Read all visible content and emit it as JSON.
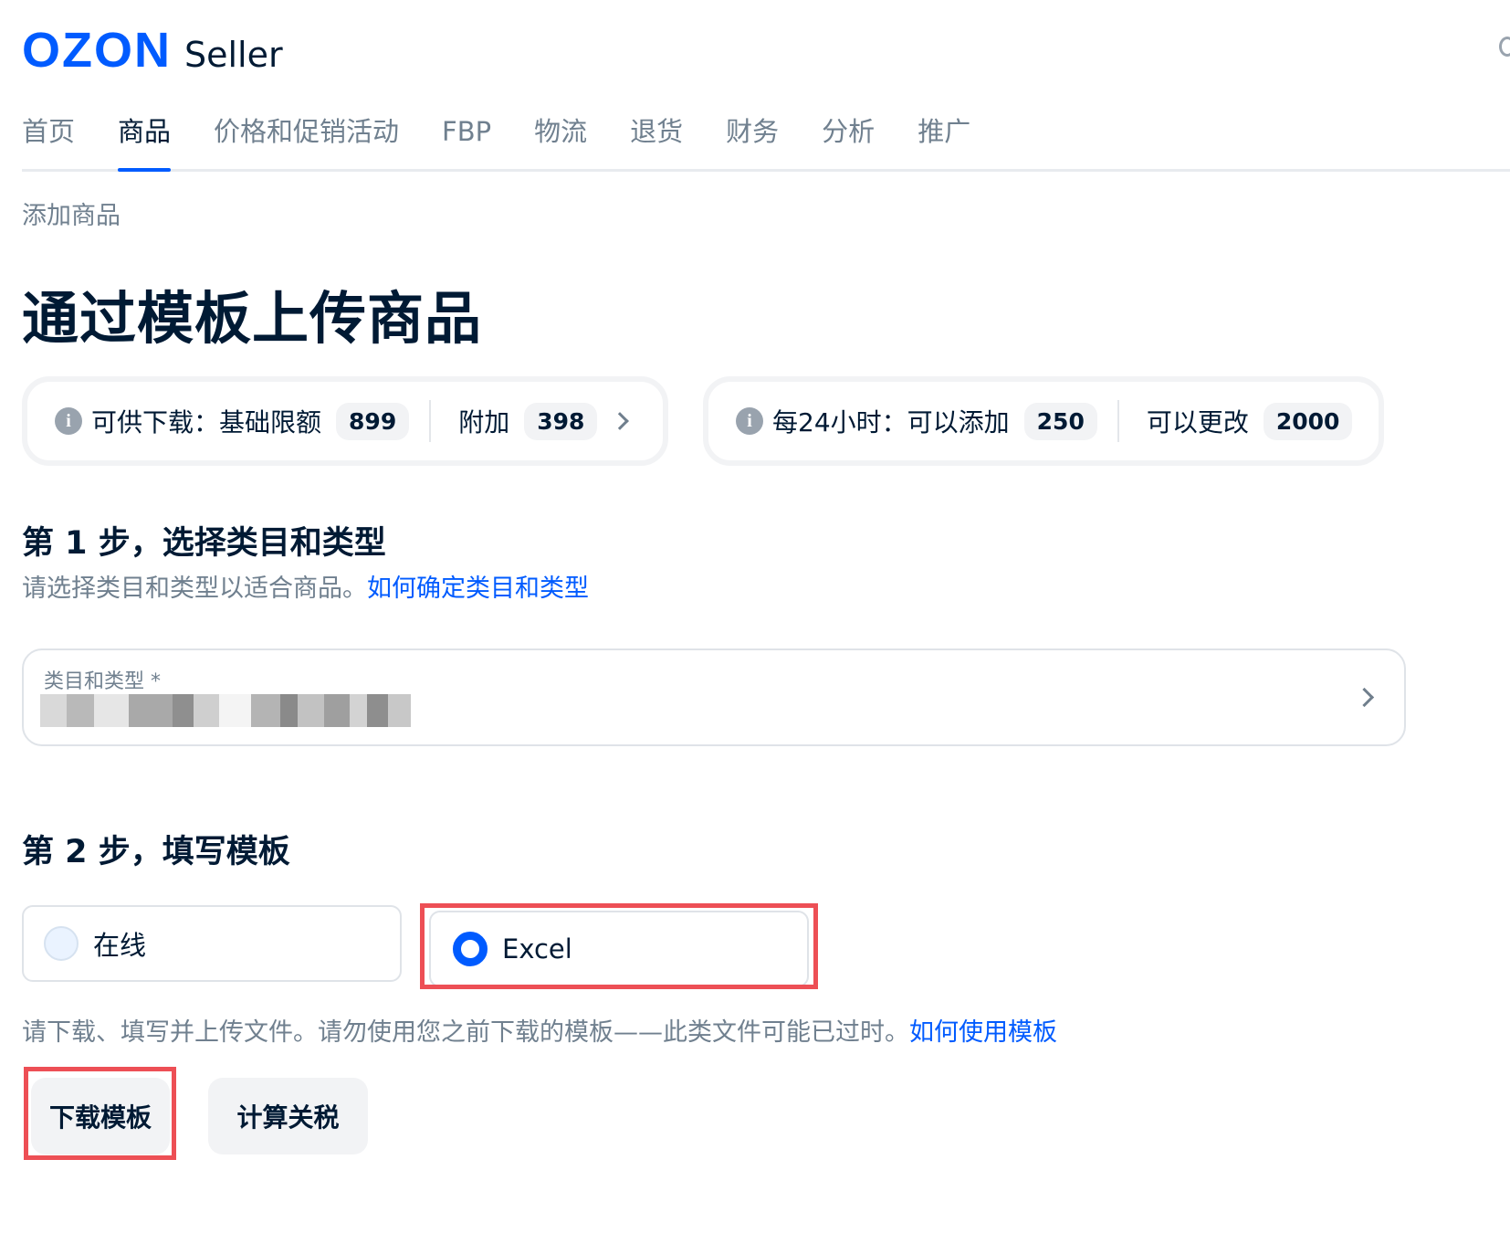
{
  "header": {
    "logo_brand": "OZON",
    "logo_product": "Seller"
  },
  "nav": {
    "items": [
      {
        "label": "首页",
        "active": false
      },
      {
        "label": "商品",
        "active": true
      },
      {
        "label": "价格和促销活动",
        "active": false
      },
      {
        "label": "FBP",
        "active": false
      },
      {
        "label": "物流",
        "active": false
      },
      {
        "label": "退货",
        "active": false
      },
      {
        "label": "财务",
        "active": false
      },
      {
        "label": "分析",
        "active": false
      },
      {
        "label": "推广",
        "active": false
      }
    ]
  },
  "breadcrumb": "添加商品",
  "page_title": "通过模板上传商品",
  "quota_download": {
    "label": "可供下载：",
    "base_label": "基础限额",
    "base_value": "899",
    "extra_label": "附加",
    "extra_value": "398"
  },
  "quota_daily": {
    "label": "每24小时：",
    "add_label": "可以添加",
    "add_value": "250",
    "change_label": "可以更改",
    "change_value": "2000"
  },
  "step1": {
    "title": "第 1 步，选择类目和类型",
    "description": "请选择类目和类型以适合商品。",
    "link": "如何确定类目和类型",
    "field_label": "类目和类型 *"
  },
  "step2": {
    "title": "第 2 步，填写模板",
    "options": [
      {
        "label": "在线",
        "selected": false
      },
      {
        "label": "Excel",
        "selected": true
      }
    ],
    "description": "请下载、填写并上传文件。请勿使用您之前下载的模板——此类文件可能已过时。",
    "link": "如何使用模板",
    "download_button": "下载模板",
    "duty_button": "计算关税"
  },
  "colors": {
    "brand": "#005bff",
    "text": "#001a34",
    "muted": "#70808f",
    "highlight": "#ed4f55"
  },
  "icons": {
    "info": "info-circle-icon",
    "chevron": "chevron-right-icon"
  }
}
